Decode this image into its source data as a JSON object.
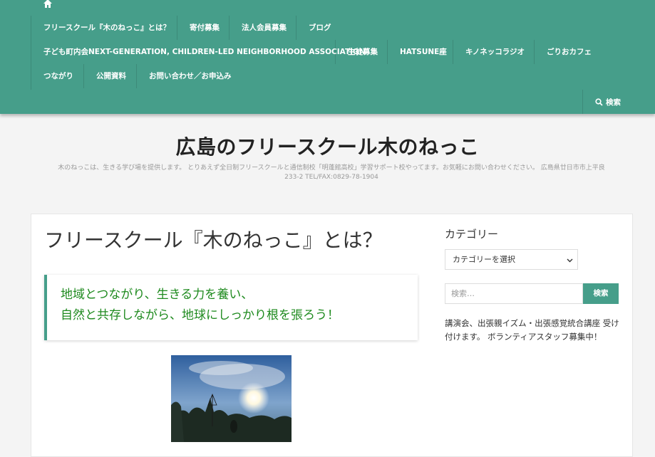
{
  "nav": {
    "row1": [
      "フリースクール『木のねっこ』とは？",
      "寄付募集",
      "法人会員募集",
      "ブログ"
    ],
    "row2": [
      "子ども町内会NEXT-GENERATION, CHILDREN-LED NEIGHBORHOOD ASSOCIATION",
      "生徒募集",
      "HATSUNE座",
      "キノネッコラジオ",
      "ごりおカフェ"
    ],
    "row3": [
      "つながり",
      "公開資料",
      "お問い合わせ／お申込み"
    ],
    "search_label": "検索",
    "home_icon": "home-icon"
  },
  "header": {
    "site_title": "広島のフリースクール木のねっこ",
    "description_line1": "木のねっこは、生きる学び場を提供します。 とりあえず全日制フリースクールと通信制校「明蓬館高校」学習サポート校やってます。お気軽にお問い合わせください。 広島県廿日市市上平良",
    "description_line2": "233-2 TEL/FAX:0829-78-1904"
  },
  "main": {
    "page_title": "フリースクール『木のねっこ』とは？",
    "quote_line1": "地域とつながり、生きる力を養い、",
    "quote_line2": "自然と共存しながら、地球にしっかり根を張ろう！"
  },
  "sidebar": {
    "category_heading": "カテゴリー",
    "category_select": "カテゴリーを選択",
    "search_placeholder": "検索…",
    "search_button": "検索",
    "text": "講演会、出張親イズム・出張感覚統合講座 受け付けます。 ボランティアスタッフ募集中！"
  },
  "colors": {
    "accent": "#469e8a",
    "quote_text": "#1e8a1e"
  }
}
